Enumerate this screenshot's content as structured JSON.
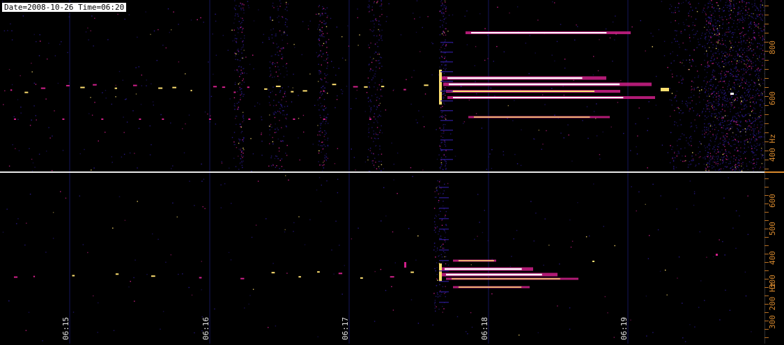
{
  "header": {
    "stamp": "Date=2008-10-26 Time=06:20"
  },
  "time_axis": {
    "labels": [
      "06:15",
      "06:16",
      "06:17",
      "06:18",
      "06:19"
    ]
  },
  "top_panel": {
    "freq_labels": [
      "800",
      "600",
      "400 Hz"
    ]
  },
  "bottom_panel": {
    "freq_labels": [
      "600",
      "500",
      "400",
      "300",
      "300 200 Hz"
    ]
  },
  "colors": {
    "background": "#000000",
    "axis_label": "#d98a2e",
    "divider": "#e8e8e8",
    "heat_low": "#2a1a8c",
    "heat_mid": "#d0208a",
    "heat_high": "#ffe070",
    "heat_max": "#ffffff"
  }
}
